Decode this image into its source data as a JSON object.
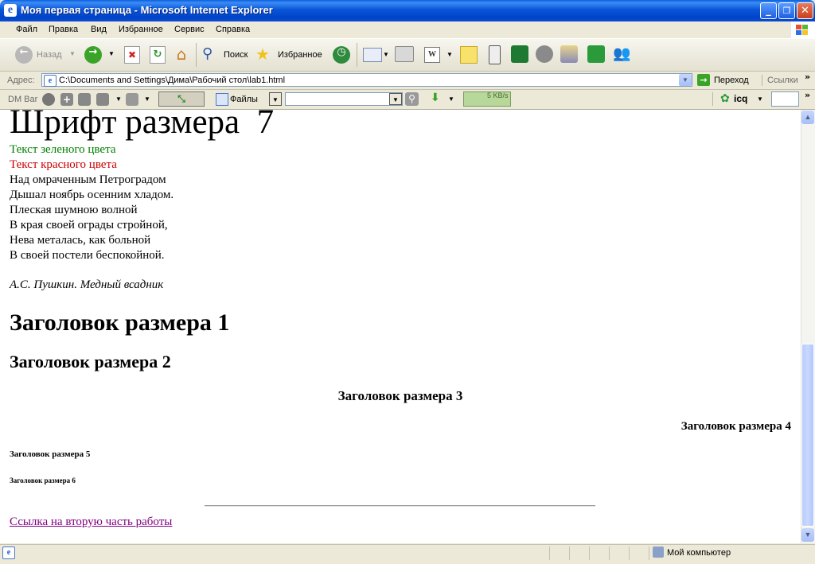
{
  "window": {
    "title": "Моя первая страница - Microsoft Internet Explorer",
    "title_icon": "ie-icon",
    "controls": {
      "minimize": "_",
      "maximize": "❐",
      "close": "✕"
    }
  },
  "menu": [
    "Файл",
    "Правка",
    "Вид",
    "Избранное",
    "Сервис",
    "Справка"
  ],
  "toolbar": {
    "back_label": "Назад",
    "search_label": "Поиск",
    "favorites_label": "Избранное"
  },
  "address": {
    "label": "Адрес:",
    "value": "C:\\Documents and Settings\\Дима\\Рабочий стол\\lab1.html",
    "go_label": "Переход",
    "links_label": "Ссылки"
  },
  "dmbar": {
    "label": "DM Bar",
    "files_label": "Файлы",
    "speed": "5 KB/s",
    "icq_label": "icq"
  },
  "page": {
    "font7_heading": "Шрифт размера  7",
    "green_text": "Текст зеленого цвета",
    "red_text": "Текст красного цвета",
    "poem": [
      "Над омраченным Петроградом",
      "Дышал ноябрь осенним хладом.",
      "Плеская шумною волной",
      "В края своей ограды стройной,",
      "Нева металась, как больной",
      "В своей постели беспокойной."
    ],
    "attribution": "А.С. Пушкин. Медный всадник",
    "h1": "Заголовок размера 1",
    "h2": "Заголовок размера 2",
    "h3": "Заголовок размера 3",
    "h4": "Заголовок размера 4",
    "h5": "Заголовок размера 5",
    "h6": "Заголовок размера 6",
    "link": "Ссылка на вторую часть работы",
    "colors": {
      "green": "#008000",
      "red": "#cc0000",
      "link_visited": "#800080"
    }
  },
  "status": {
    "zone": "Мой компьютер"
  }
}
